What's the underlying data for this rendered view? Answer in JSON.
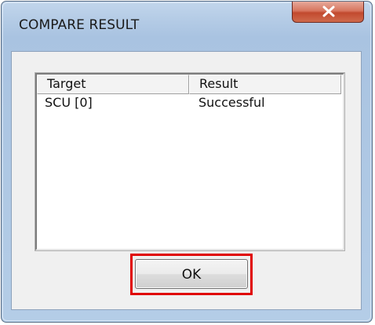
{
  "window": {
    "title": "COMPARE RESULT",
    "close_icon": "close-icon"
  },
  "list": {
    "columns": [
      "Target",
      "Result"
    ],
    "rows": [
      {
        "target": "SCU [0]",
        "result": "Successful"
      }
    ]
  },
  "buttons": {
    "ok_label": "OK"
  },
  "colors": {
    "highlight": "#e00000",
    "close_button": "#c24a2f"
  }
}
